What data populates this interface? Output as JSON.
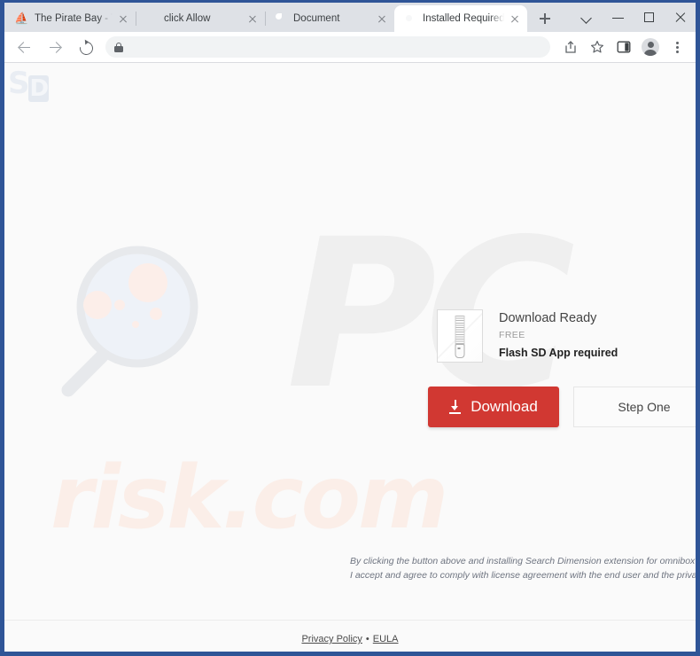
{
  "browser": {
    "tabs": [
      {
        "title": "The Pirate Bay - The gal",
        "icon": "pirate-ship-icon",
        "active": false
      },
      {
        "title": "click Allow",
        "icon": "red-dot-icon",
        "active": false
      },
      {
        "title": "Document",
        "icon": "globe-icon",
        "active": false
      },
      {
        "title": "Installed Required",
        "icon": "chrome-icon",
        "active": true
      }
    ],
    "new_tab_label": "+",
    "window_controls": {
      "tab_search": "tab-search-chevron",
      "minimize": "minimize",
      "maximize": "maximize",
      "close": "close"
    },
    "toolbar": {
      "back": "back-arrow-icon",
      "forward": "forward-arrow-icon",
      "reload": "reload-icon",
      "omnibox_value": "",
      "omnibox_placeholder": "",
      "lock": "lock-icon",
      "share": "share-icon",
      "bookmark": "star-icon",
      "side_panel": "side-panel-icon",
      "profile": "profile-avatar-icon",
      "menu": "three-dot-menu-icon"
    }
  },
  "watermarks": {
    "logo_s": "S",
    "logo_v": "D",
    "big_text": "PC",
    "domain_text": "risk.com"
  },
  "page": {
    "card": {
      "icon": "zip-archive-icon",
      "title": "Download Ready",
      "price": "FREE",
      "requirement": "Flash SD App required"
    },
    "buttons": {
      "download_label": "Download",
      "download_icon": "download-arrow-icon",
      "step_one_label": "Step One"
    },
    "disclaimer_line1": "By clicking the button above and installing Search Dimension extension for omnibox",
    "disclaimer_line2": "I accept and agree to comply with license agreement with the end user and the privacy p",
    "footer": {
      "privacy_policy": "Privacy Policy",
      "separator": "•",
      "eula": "EULA"
    }
  },
  "colors": {
    "download_button": "#d13832",
    "window_border": "#2f5597",
    "tabstrip": "#dee1e6",
    "page_background": "#fafafa",
    "watermark_gray": "#efefef",
    "watermark_pink": "#fbeee8"
  }
}
